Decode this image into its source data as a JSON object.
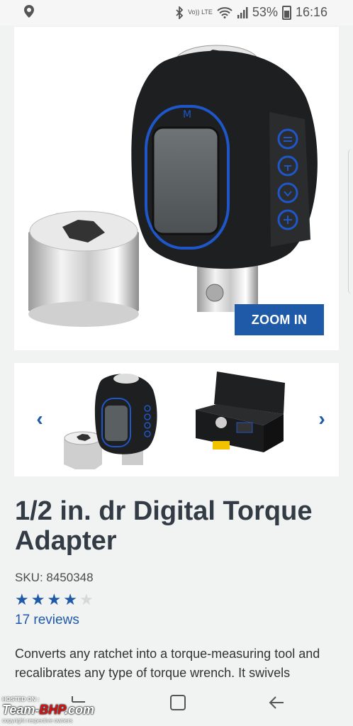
{
  "status_bar": {
    "network_label": "Vo)) LTE",
    "battery": "53%",
    "time": "16:16"
  },
  "hero": {
    "zoom_label": "ZOOM IN"
  },
  "product": {
    "title": "1/2 in. dr Digital Torque Adapter",
    "sku": "SKU: 8450348",
    "rating": 4,
    "rating_max": 5,
    "reviews": "17 reviews",
    "description": "Converts any ratchet into a torque-measuring tool and recalibrates any type of torque wrench. It swivels"
  },
  "watermark": {
    "hosted": "HOSTED ON :",
    "brand_left": "Team-",
    "brand_mid": "BHP",
    "brand_right": ".com",
    "copyright": "copyright respective owners"
  },
  "colors": {
    "accent": "#1e5aa8",
    "background": "#f1f2f2",
    "star_empty": "#d6d8da"
  }
}
